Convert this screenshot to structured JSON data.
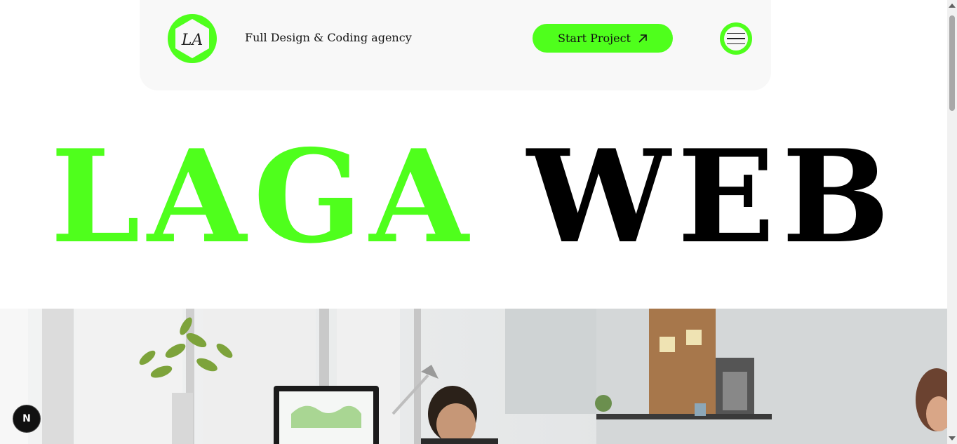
{
  "header": {
    "logo_text": "LA",
    "tagline": "Full Design & Coding agency",
    "cta_label": "Start Project",
    "cta_icon": "arrow-up-right-icon",
    "menu_icon": "hamburger-menu-icon"
  },
  "hero": {
    "word1": "LAGA",
    "word2": "WEB"
  },
  "image": {
    "description_icon": "office-photo"
  },
  "badge": {
    "label": "N"
  },
  "colors": {
    "accent": "#4fff1c",
    "header_bg": "#f8f8f8",
    "text": "#111111"
  }
}
